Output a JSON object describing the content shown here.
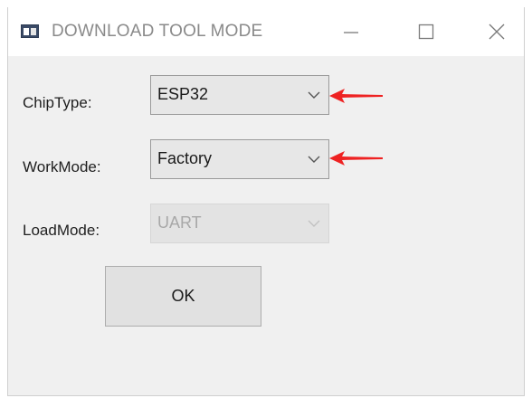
{
  "window": {
    "title": "DOWNLOAD TOOL MODE",
    "icon": "app-icon",
    "controls": [
      "minimize-icon",
      "maximize-icon",
      "close-icon"
    ]
  },
  "form": {
    "chip_type": {
      "label": "ChipType:",
      "value": "ESP32",
      "enabled": true
    },
    "work_mode": {
      "label": "WorkMode:",
      "value": "Factory",
      "enabled": true
    },
    "load_mode": {
      "label": "LoadMode:",
      "value": "UART",
      "enabled": false
    }
  },
  "ok_button": {
    "label": "OK"
  },
  "annotations": {
    "arrow_color": "#ee2222",
    "arrow_targets": [
      "chip-type-select",
      "work-mode-select"
    ]
  },
  "colors": {
    "window_bg": "#f0f0f0",
    "titlebar_bg": "#ffffff",
    "title_text": "#8a8a8a",
    "disabled_text": "#a8a8a8"
  }
}
